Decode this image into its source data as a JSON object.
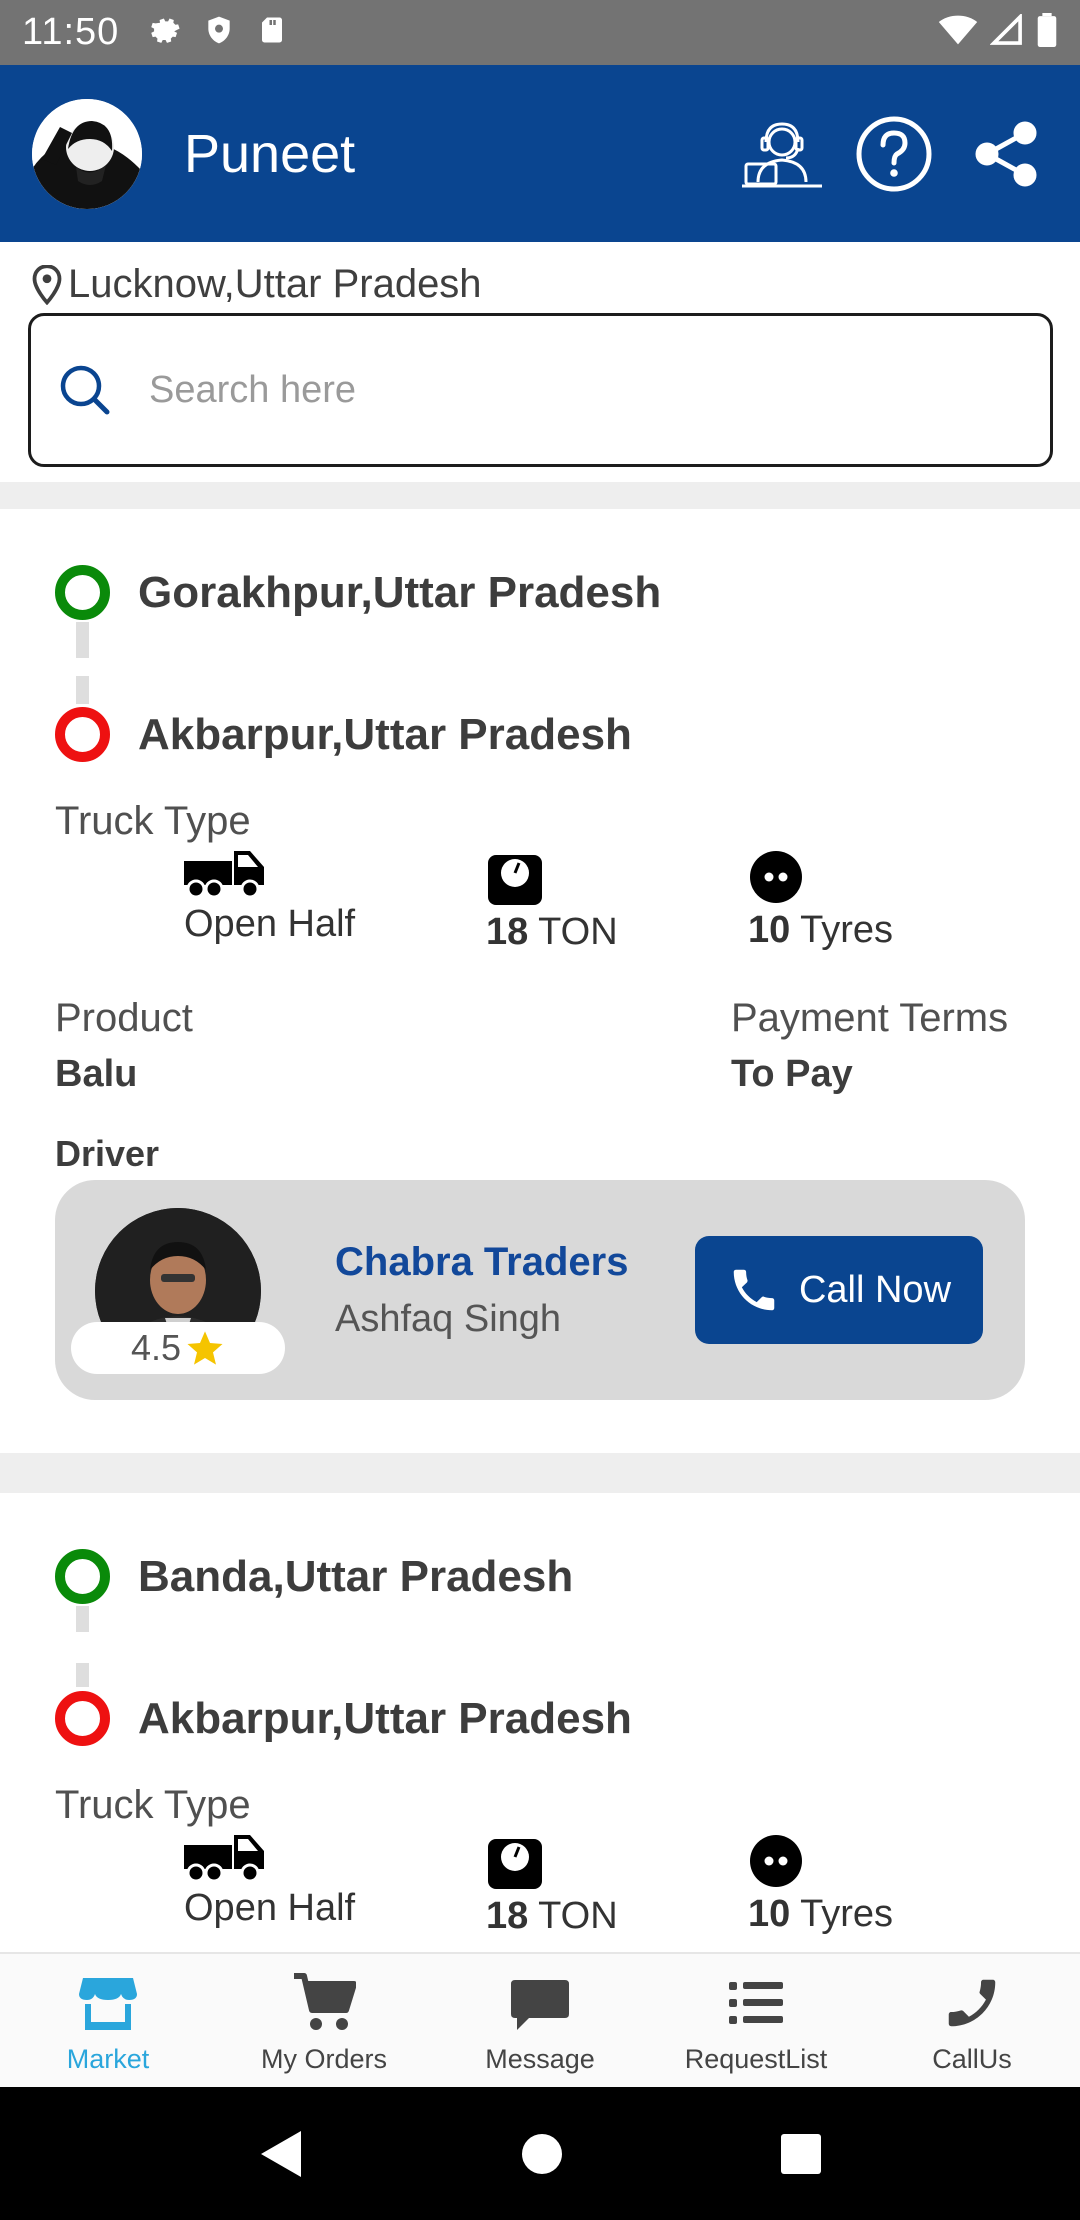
{
  "status_bar": {
    "time": "11:50"
  },
  "header": {
    "title": "Puneet"
  },
  "location": {
    "text": "Lucknow,Uttar Pradesh"
  },
  "search": {
    "placeholder": "Search here"
  },
  "cards": [
    {
      "from": "Gorakhpur,Uttar Pradesh",
      "to": "Akbarpur,Uttar Pradesh",
      "truck_type_label": "Truck Type",
      "truck_body": "Open Half",
      "capacity_value": "18",
      "capacity_unit": "TON",
      "tyres_value": "10",
      "tyres_unit": "Tyres",
      "product_label": "Product",
      "product_value": "Balu",
      "payment_label": "Payment Terms",
      "payment_value": "To Pay",
      "driver_label": "Driver",
      "rating": "4.5",
      "company": "Chabra Traders",
      "driver_name": "Ashfaq Singh",
      "call_label": "Call Now"
    },
    {
      "from": "Banda,Uttar Pradesh",
      "to": "Akbarpur,Uttar Pradesh",
      "truck_type_label": "Truck Type",
      "truck_body": "Open Half",
      "capacity_value": "18",
      "capacity_unit": "TON",
      "tyres_value": "10",
      "tyres_unit": "Tyres"
    }
  ],
  "bottom_nav": [
    {
      "label": "Market",
      "icon": "store-icon",
      "active": true
    },
    {
      "label": "My Orders",
      "icon": "cart-icon",
      "active": false
    },
    {
      "label": "Message",
      "icon": "message-icon",
      "active": false
    },
    {
      "label": "RequestList",
      "icon": "list-icon",
      "active": false
    },
    {
      "label": "CallUs",
      "icon": "phone-icon",
      "active": false
    }
  ],
  "colors": {
    "primary": "#0a4590",
    "active_tab": "#2aa6dc",
    "origin_dot": "#0a8a0a",
    "destination_dot": "#ee1111",
    "rating_star": "#f5c400"
  }
}
